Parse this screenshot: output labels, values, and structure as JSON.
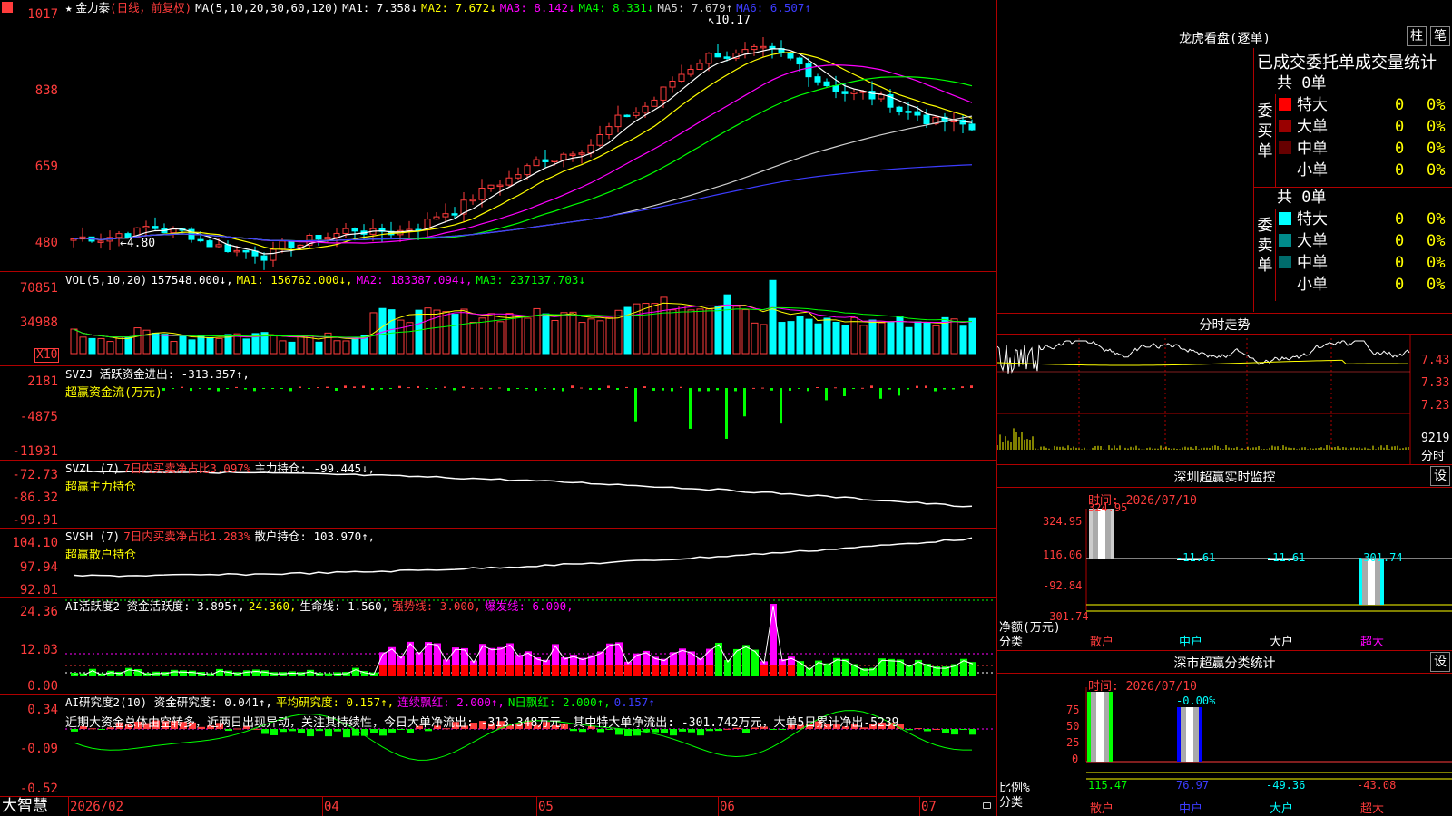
{
  "app": {
    "logo": "大智慧",
    "menu_icon": "hamburger-icon"
  },
  "kline": {
    "star": "★",
    "name": "金力泰",
    "period": "(日线，前复权)",
    "ma_label": "MA(5,10,20,30,60,120)",
    "ma": [
      {
        "label": "MA1: 7.358↓",
        "color": "#ffffff"
      },
      {
        "label": "MA2: 7.672↓",
        "color": "#ffff00"
      },
      {
        "label": "MA3: 8.142↓",
        "color": "#ff00ff"
      },
      {
        "label": "MA4: 8.331↓",
        "color": "#00ff00"
      },
      {
        "label": "MA5: 7.679↑",
        "color": "#cfcfcf"
      },
      {
        "label": "MA6: 6.507↑",
        "color": "#3c3cff"
      }
    ],
    "y_labels": [
      "1017",
      "838",
      "659",
      "480"
    ],
    "high_mark": "10.17",
    "low_mark": "4.80"
  },
  "vol": {
    "legend": [
      {
        "label": "VOL(5,10,20)",
        "color": "#ffffff"
      },
      {
        "label": "157548.000↓,",
        "color": "#ffffff"
      },
      {
        "label": "MA1: 156762.000↓,",
        "color": "#ffff00"
      },
      {
        "label": "MA2: 183387.094↓,",
        "color": "#ff00ff"
      },
      {
        "label": "MA3: 237137.703↓",
        "color": "#00ff00"
      }
    ],
    "y_labels": [
      "70851",
      "34988"
    ],
    "unit": "X10"
  },
  "svzj": {
    "line1": [
      {
        "label": "SVZJ  活跃资金进出: -313.357↑,",
        "color": "#ffffff"
      }
    ],
    "line2": "超赢资金流(万元)",
    "y_labels": [
      "2181",
      "-4875",
      "-11931"
    ]
  },
  "svzl": {
    "line1": [
      {
        "label": "SVZL (7)",
        "color": "#ffffff"
      },
      {
        "label": "7日内买卖净占比3.097%",
        "color": "#ff3c3c"
      },
      {
        "label": "主力持仓: -99.445↓,",
        "color": "#ffffff"
      }
    ],
    "line2": "超赢主力持仓",
    "y_labels": [
      "-72.73",
      "-86.32",
      "-99.91"
    ]
  },
  "svsh": {
    "line1": [
      {
        "label": "SVSH (7)",
        "color": "#ffffff"
      },
      {
        "label": "7日内买卖净占比1.283%",
        "color": "#ff3c3c"
      },
      {
        "label": "散户持仓: 103.970↑,",
        "color": "#ffffff"
      }
    ],
    "line2": "超赢散户持仓",
    "y_labels": [
      "104.10",
      "97.94",
      "92.01"
    ]
  },
  "ai_active": {
    "legend": [
      {
        "label": "AI活跃度2 资金活跃度: 3.895↑,",
        "color": "#ffffff"
      },
      {
        "label": "24.360,",
        "color": "#ffff00"
      },
      {
        "label": "生命线: 1.560,",
        "color": "#ffffff"
      },
      {
        "label": "强势线: 3.000,",
        "color": "#ff3c3c"
      },
      {
        "label": "爆发线: 6.000,",
        "color": "#ff00ff"
      }
    ],
    "y_labels": [
      "24.36",
      "12.03",
      "0.00"
    ]
  },
  "ai_research": {
    "legend": [
      {
        "label": "AI研究度2(10) 资金研究度: 0.041↑,",
        "color": "#ffffff"
      },
      {
        "label": "平均研究度: 0.157↑,",
        "color": "#ffff00"
      },
      {
        "label": "连续飘红: 2.000↑,",
        "color": "#ff00ff"
      },
      {
        "label": "N日飘红: 2.000↑,",
        "color": "#00ff00"
      },
      {
        "label": "0.157↑",
        "color": "#3c3cff"
      }
    ],
    "comment": "近期大资金总体由空转多，近两日出现异动，关注其持续性，今日大单净流出: -313.348万元，其中特大单净流出: -301.742万元，大单5日累计净出-5239",
    "y_labels": [
      "0.34",
      "-0.09",
      "-0.52"
    ]
  },
  "xaxis": [
    "2026/02",
    "04",
    "05",
    "06",
    "07"
  ],
  "right": {
    "lhb_title": "龙虎看盘(逐单)",
    "btn_bar": "柱",
    "btn_pen": "笔",
    "tabs": "已成交委托单成交量统计",
    "buy": {
      "side": "委买单",
      "total": "共 0单",
      "rows": [
        {
          "name": "特大",
          "value": "0",
          "pct": "0%",
          "color": "#ff0000"
        },
        {
          "name": "大单",
          "value": "0",
          "pct": "0%",
          "color": "#990000"
        },
        {
          "name": "中单",
          "value": "0",
          "pct": "0%",
          "color": "#660000"
        },
        {
          "name": "小单",
          "value": "0",
          "pct": "0%",
          "color": "#000000"
        }
      ]
    },
    "sell": {
      "side": "委卖单",
      "total": "共 0单",
      "rows": [
        {
          "name": "特大",
          "value": "0",
          "pct": "0%",
          "color": "#00ffff"
        },
        {
          "name": "大单",
          "value": "0",
          "pct": "0%",
          "color": "#008b8b"
        },
        {
          "name": "中单",
          "value": "0",
          "pct": "0%",
          "color": "#006b6b"
        },
        {
          "name": "小单",
          "value": "0",
          "pct": "0%",
          "color": "#000000"
        }
      ]
    },
    "intraday": {
      "title": "分时走势",
      "prices": [
        "7.43",
        "7.33",
        "7.23"
      ],
      "volume": "9219",
      "unit": "分时"
    },
    "monitor": {
      "title": "深圳超赢实时监控",
      "btn": "设",
      "time": "时间: 2026/07/10",
      "y_labels": [
        "324.95",
        "116.06",
        "-92.84",
        "-301.74"
      ],
      "cat_label1": "净额(万元)",
      "cat_label2": "分类",
      "cats": [
        "散户",
        "中户",
        "大户",
        "超大"
      ],
      "values": [
        "324.95",
        "-11.61",
        "-11.61",
        "-301.74"
      ]
    },
    "classify": {
      "title": "深市超赢分类统计",
      "btn": "设",
      "time": "时间: 2026/07/10",
      "y_labels": [
        "75",
        "50",
        "25",
        "0"
      ],
      "cat_label1": "比例%",
      "cat_label2": "分类",
      "cats": [
        "散户",
        "中户",
        "大户",
        "超大"
      ],
      "values": [
        "115.47",
        "76.97",
        "-49.36",
        "-43.08"
      ],
      "top_label": "-0.00%"
    }
  },
  "colors": {
    "up": "#ff3c3c",
    "down": "#00ffff",
    "grid": "#b00000",
    "axis_text": "#ff3c3c"
  }
}
